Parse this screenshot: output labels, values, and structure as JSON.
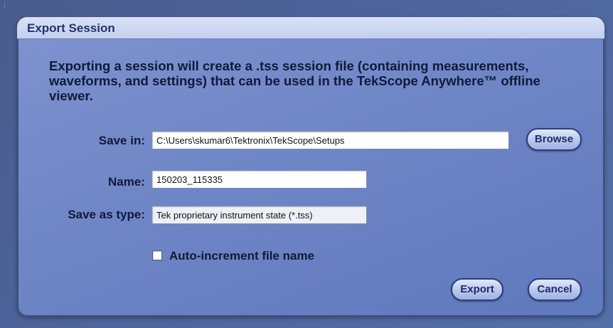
{
  "dialog": {
    "title": "Export Session",
    "description": "Exporting a session will create a .tss session file (containing measurements, waveforms, and settings) that can be used in the TekScope Anywhere™ offline viewer."
  },
  "form": {
    "save_in": {
      "label": "Save in:",
      "value": "C:\\Users\\skumar6\\Tektronix\\TekScope\\Setups"
    },
    "name": {
      "label": "Name:",
      "value": "150203_115335"
    },
    "save_as_type": {
      "label": "Save as type:",
      "value": "Tek proprietary instrument state (*.tss)"
    },
    "auto_increment": {
      "label": "Auto-increment file name",
      "checked": false
    }
  },
  "buttons": {
    "browse": "Browse",
    "export": "Export",
    "cancel": "Cancel"
  },
  "colors": {
    "background": "#4d639a",
    "dialog": "#7088c7",
    "title_bar": "#cdd7f2",
    "button_border": "#2b3f7a"
  },
  "icons": {
    "window_grip": "grip-dots-icon"
  }
}
